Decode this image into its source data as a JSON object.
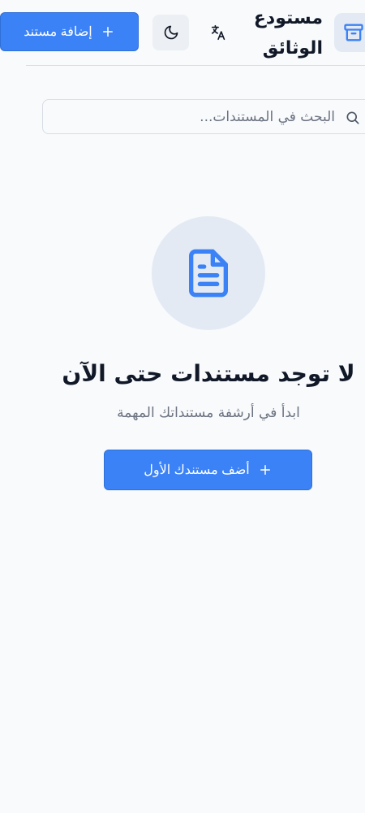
{
  "header": {
    "title": "مستودع الوثائق",
    "add_button_label": "إضافة مستند",
    "icons": {
      "logo": "archive-box-icon",
      "language": "translate-icon",
      "theme": "moon-icon",
      "add": "plus-icon"
    }
  },
  "search": {
    "placeholder": "البحث في المستندات...",
    "value": "",
    "icon": "search-icon"
  },
  "empty_state": {
    "icon": "document-icon",
    "title": "لا توجد مستندات حتى الآن",
    "subtitle": "ابدأ في أرشفة مستنداتك المهمة",
    "button_label": "أضف مستندك الأول"
  },
  "colors": {
    "primary": "#3b82f6",
    "background": "#f8fafc",
    "icon_background": "#e3eaf4",
    "text": "#111827",
    "muted_text": "#6b7280"
  }
}
